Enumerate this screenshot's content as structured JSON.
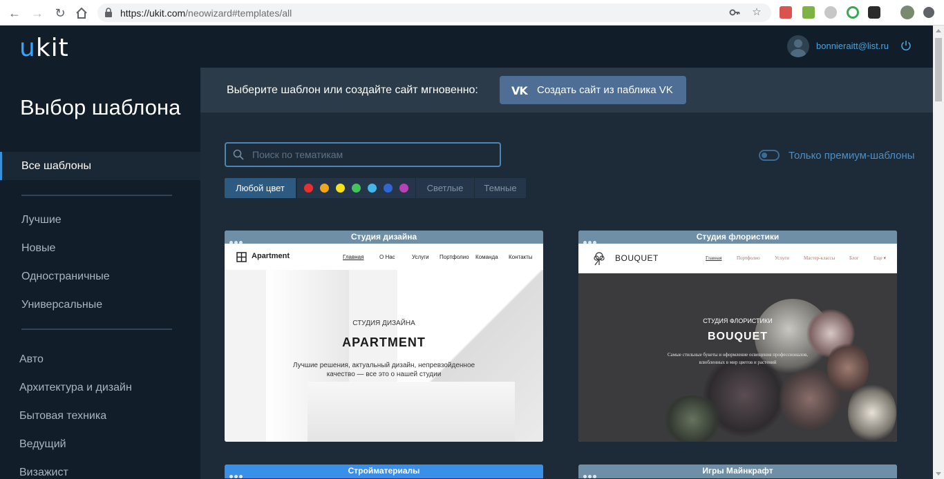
{
  "browser": {
    "url_host": "https://ukit.com",
    "url_path": "/neowizard#templates/all"
  },
  "header": {
    "logo_u": "u",
    "logo_rest": "kit",
    "user_email": "bonnieraitt@list.ru"
  },
  "sidebar": {
    "title": "Выбор шаблона",
    "active_item": "Все шаблоны",
    "groups": [
      "Лучшие",
      "Новые",
      "Одностраничные",
      "Универсальные"
    ],
    "categories": [
      "Авто",
      "Архитектура и дизайн",
      "Бытовая техника",
      "Ведущий",
      "Визажист"
    ]
  },
  "banner": {
    "text": "Выберите шаблон или создайте сайт мгновенно:",
    "vk_button_label": "Создать сайт из паблика VK",
    "vk_icon_text": "VK"
  },
  "filters": {
    "search_placeholder": "Поиск по тематикам",
    "premium_toggle_label": "Только премиум-шаблоны",
    "premium_only": false,
    "any_color_label": "Любой цвет",
    "colors": [
      "#e8312f",
      "#f2a71b",
      "#f5e21c",
      "#44c45a",
      "#45b6e8",
      "#2f66d4",
      "#b742b5"
    ],
    "light_label": "Светлые",
    "dark_label": "Темные"
  },
  "templates": [
    {
      "title": "Студия дизайна",
      "brand": "Apartment",
      "nav": [
        "Главная",
        "О Нас",
        "Услуги",
        "Портфолио",
        "Команда",
        "Контакты"
      ],
      "kicker": "СТУДИЯ ДИЗАЙНА",
      "headline": "APARTMENT",
      "subtitle_line1": "Лучшие решения, актуальный дизайн, непревзойденное",
      "subtitle_line2": "качество — все это о нашей студии"
    },
    {
      "title": "Студия флористики",
      "brand": "BOUQUET",
      "nav": [
        "Главная",
        "Портфолио",
        "Услуги",
        "Мастер-классы",
        "Блог",
        "Еще ▾"
      ],
      "kicker": "СТУДИЯ ФЛОРИСТИКИ",
      "headline": "BOUQUET",
      "subtitle_line1": "Самые стильные букеты и оформление освещения профессионалов,",
      "subtitle_line2": "влюбленных в мир цветов и растений"
    },
    {
      "title": "Стройматериалы"
    },
    {
      "title": "Игры Майнкрафт"
    }
  ]
}
